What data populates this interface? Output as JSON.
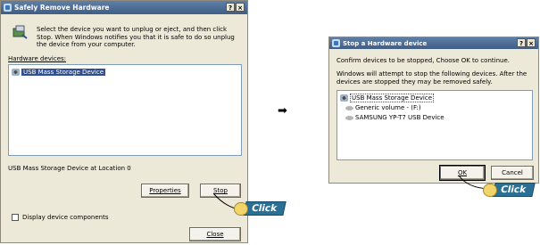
{
  "left_dialog": {
    "title": "Safely Remove Hardware",
    "help_btn": "?",
    "close_btn": "×",
    "description": "Select the device you want to unplug or eject, and then click Stop. When Windows notifies you that it is safe to do so unplug the device from your computer.",
    "devices_label": "Hardware devices:",
    "devices": [
      "USB Mass Storage Device"
    ],
    "device_location": "USB Mass Storage Device at Location 0",
    "properties_button": "Properties",
    "stop_button": "Stop",
    "display_components_label": "Display device components",
    "close_button": "Close",
    "click_label": "Click"
  },
  "right_dialog": {
    "title": "Stop a Hardware device",
    "help_btn": "?",
    "close_btn": "×",
    "confirm_text": "Confirm devices to be stopped, Choose OK to continue.",
    "info_text": "Windows will attempt to stop the following devices. After the devices are stopped they may be removed safely.",
    "devices": [
      "USB Mass Storage Device",
      "Generic volume - (F:)",
      "SAMSUNG YP-T7 USB Device"
    ],
    "ok_button": "OK",
    "cancel_button": "Cancel",
    "click_label": "Click"
  },
  "arrow_symbol": "➡"
}
